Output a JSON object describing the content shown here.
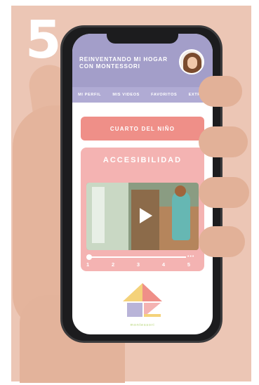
{
  "step_number": "5",
  "app": {
    "title": "REINVENTANDO MI HOGAR CON MONTESSORI"
  },
  "nav": {
    "items": [
      "MI PERFIL",
      "MIS VIDEOS",
      "FAVORITOS",
      "EXTRAS"
    ]
  },
  "room_button": {
    "label": "CUARTO DEL NIÑO"
  },
  "section": {
    "title": "ACCESIBILIDAD",
    "timeline_ticks": [
      "1",
      "2",
      "3",
      "4",
      "5"
    ],
    "timeline_more": "•••"
  },
  "brand": {
    "name": "montessori"
  },
  "colors": {
    "background": "#ecc6b5",
    "header": "#a39ec9",
    "nav": "#b0abd4",
    "button": "#ef8f88",
    "card": "#f4b3b2"
  },
  "icons": {
    "play": "play-icon"
  }
}
